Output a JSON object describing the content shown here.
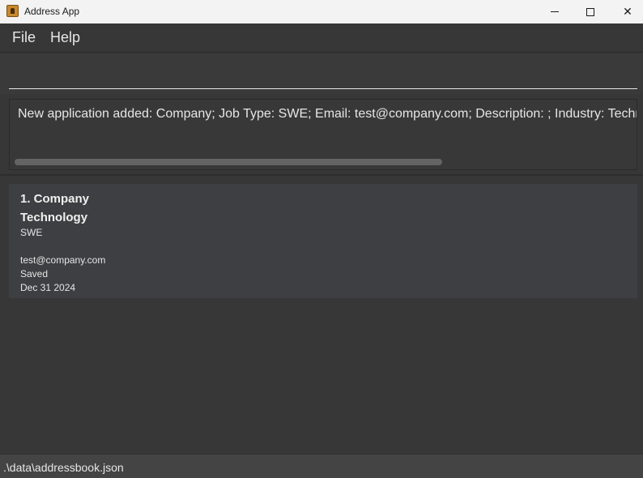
{
  "window": {
    "title": "Address App",
    "minimize_glyph": "",
    "maximize_glyph": "",
    "close_glyph": "✕"
  },
  "menu": {
    "file": "File",
    "help": "Help"
  },
  "command": {
    "value": ""
  },
  "result": {
    "text": "New application added: Company; Job Type: SWE; Email: test@company.com; Description: ; Industry: Technology"
  },
  "applications": [
    {
      "title": "1. Company",
      "industry": "Technology",
      "job_type": "SWE",
      "description": "",
      "email": "test@company.com",
      "status": "Saved",
      "deadline": "Dec 31 2024"
    }
  ],
  "status_bar": {
    "path": ".\\data\\addressbook.json"
  },
  "colors": {
    "background": "#373737",
    "card": "#3e3f42",
    "titlebar": "#f3f3f3"
  }
}
